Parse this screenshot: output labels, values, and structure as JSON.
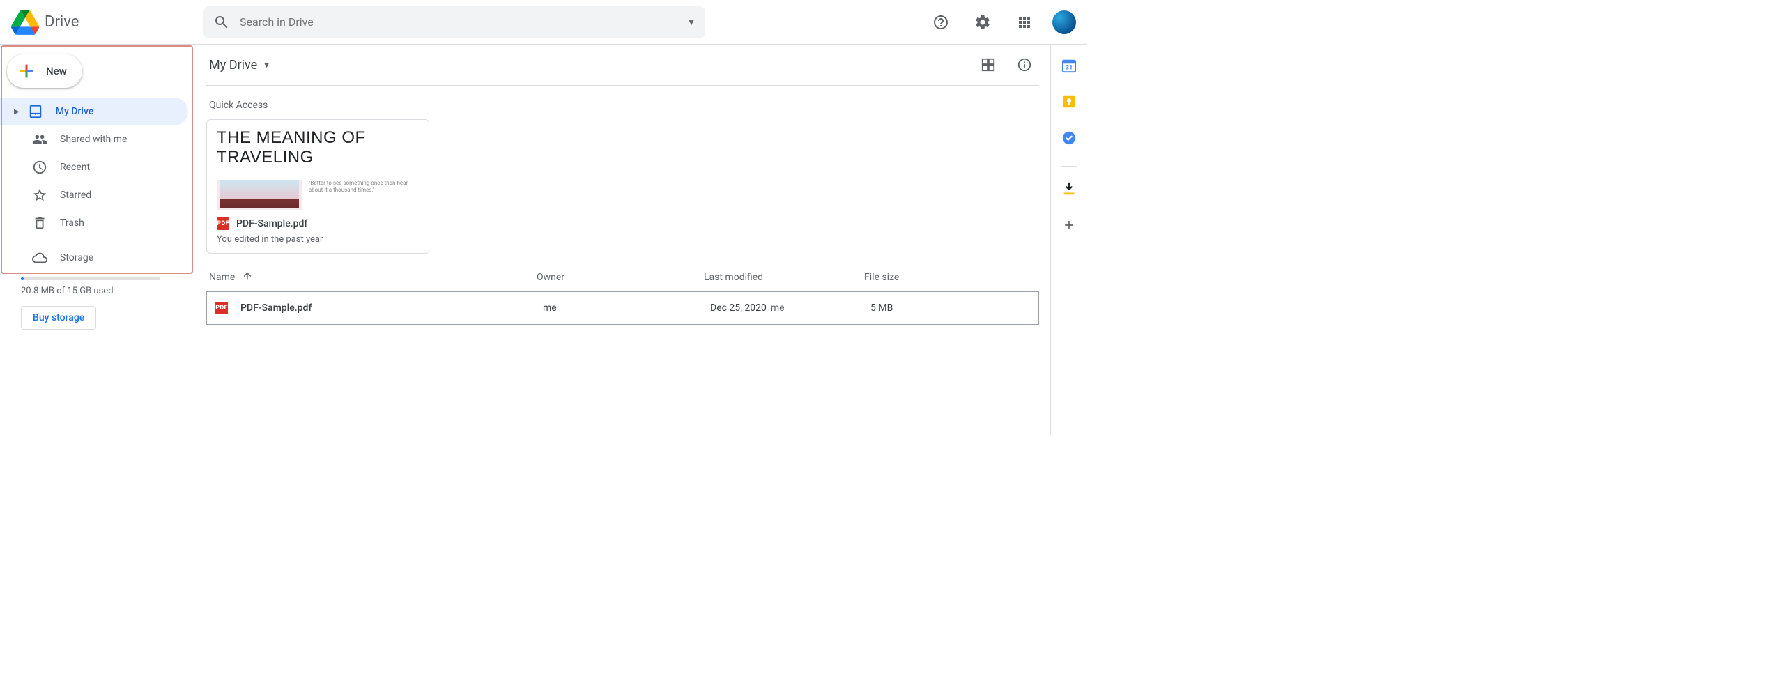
{
  "header": {
    "app_name": "Drive",
    "search_placeholder": "Search in Drive"
  },
  "sidebar": {
    "new_label": "New",
    "items": [
      {
        "label": "My Drive"
      },
      {
        "label": "Shared with me"
      },
      {
        "label": "Recent"
      },
      {
        "label": "Starred"
      },
      {
        "label": "Trash"
      }
    ],
    "storage_label": "Storage",
    "storage_used_text": "20.8 MB of 15 GB used",
    "buy_label": "Buy storage"
  },
  "main": {
    "breadcrumb": "My Drive",
    "quick_access_title": "Quick Access",
    "qa_card": {
      "headline": "THE MEANING OF TRAVELING",
      "blurb": "\"Better to see something once than hear about it a thousand times.\"",
      "filename": "PDF-Sample.pdf",
      "subtitle": "You edited in the past year"
    },
    "columns": {
      "name": "Name",
      "owner": "Owner",
      "modified": "Last modified",
      "size": "File size"
    },
    "rows": [
      {
        "name": "PDF-Sample.pdf",
        "owner": "me",
        "modified_date": "Dec 25, 2020",
        "modified_by": "me",
        "size": "5 MB"
      }
    ]
  },
  "pdf_badge": "PDF"
}
